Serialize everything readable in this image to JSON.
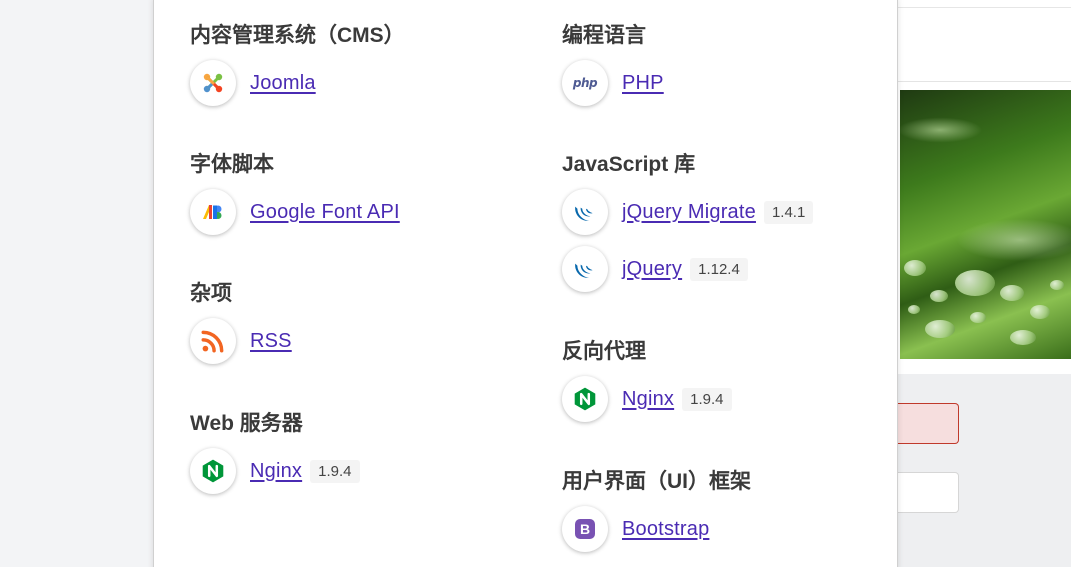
{
  "left_column": [
    {
      "title": "内容管理系统（CMS）",
      "items": [
        {
          "name": "Joomla",
          "icon": "joomla-icon",
          "version": ""
        }
      ]
    },
    {
      "title": "字体脚本",
      "items": [
        {
          "name": "Google Font API",
          "icon": "google-fonts-icon",
          "version": ""
        }
      ]
    },
    {
      "title": "杂项",
      "items": [
        {
          "name": "RSS",
          "icon": "rss-icon",
          "version": ""
        }
      ]
    },
    {
      "title": "Web 服务器",
      "items": [
        {
          "name": "Nginx",
          "icon": "nginx-icon",
          "version": "1.9.4"
        }
      ]
    }
  ],
  "right_column": [
    {
      "title": "编程语言",
      "items": [
        {
          "name": "PHP",
          "icon": "php-icon",
          "icon_text": "php",
          "version": ""
        }
      ]
    },
    {
      "title": "JavaScript 库",
      "items": [
        {
          "name": "jQuery Migrate",
          "icon": "jquery-icon",
          "version": "1.4.1"
        },
        {
          "name": "jQuery",
          "icon": "jquery-icon",
          "version": "1.12.4"
        }
      ]
    },
    {
      "title": "反向代理",
      "items": [
        {
          "name": "Nginx",
          "icon": "nginx-icon",
          "version": "1.9.4"
        }
      ]
    },
    {
      "title": "用户界面（UI）框架",
      "items": [
        {
          "name": "Bootstrap",
          "icon": "bootstrap-icon",
          "icon_text": "B",
          "version": ""
        }
      ]
    }
  ],
  "colors": {
    "link": "#4a2bb3",
    "heading": "#3a3a3a",
    "nginx": "#009639",
    "bootstrap": "#7952b3",
    "rss": "#f26522",
    "jquery": "#0868ac",
    "error_field_border": "#c0392b"
  }
}
